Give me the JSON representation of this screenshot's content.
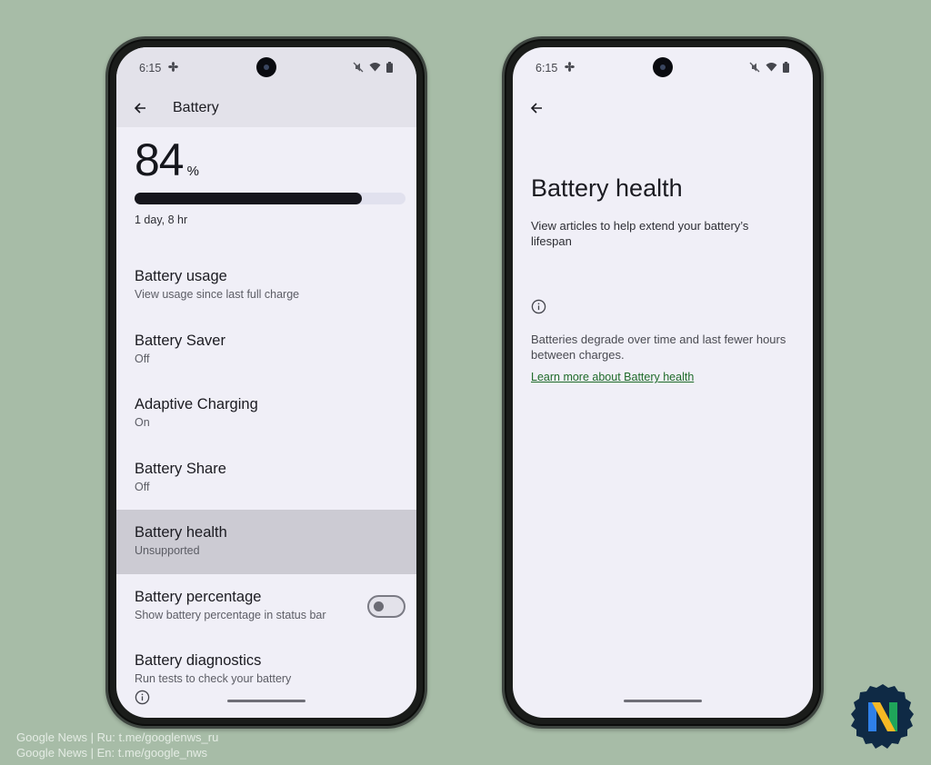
{
  "status_bar": {
    "time": "6:15",
    "icons": [
      "fan-icon",
      "mute-icon",
      "wifi-icon",
      "battery-icon"
    ]
  },
  "left_screen": {
    "app_bar": {
      "back_icon": "arrow-left-icon",
      "title": "Battery"
    },
    "battery": {
      "percent": "84",
      "percent_sign": "%",
      "level_fraction": 0.84,
      "time_remaining": "1 day, 8 hr"
    },
    "items": [
      {
        "title": "Battery usage",
        "subtitle": "View usage since last full charge"
      },
      {
        "title": "Battery Saver",
        "subtitle": "Off"
      },
      {
        "title": "Adaptive Charging",
        "subtitle": "On"
      },
      {
        "title": "Battery Share",
        "subtitle": "Off"
      },
      {
        "title": "Battery health",
        "subtitle": "Unsupported",
        "highlighted": true
      },
      {
        "title": "Battery percentage",
        "subtitle": "Show battery percentage in status bar",
        "toggle": false
      },
      {
        "title": "Battery diagnostics",
        "subtitle": "Run tests to check your battery"
      }
    ],
    "footer_icon": "info-icon"
  },
  "right_screen": {
    "app_bar": {
      "back_icon": "arrow-left-icon"
    },
    "title": "Battery health",
    "description": "View articles to help extend your battery’s lifespan",
    "info_icon": "info-icon",
    "note": "Batteries degrade over time and last fewer hours between charges.",
    "link": "Learn more about Battery health"
  },
  "credits": {
    "line1": "Google News | Ru: t.me/googlenws_ru",
    "line2": "Google News | En: t.me/google_nws"
  },
  "colors": {
    "background": "#a7bca7",
    "screen": "#f0eff7",
    "highlight": "#cccbd3",
    "link": "#1f6b2a",
    "battery_fill": "#16161c"
  }
}
